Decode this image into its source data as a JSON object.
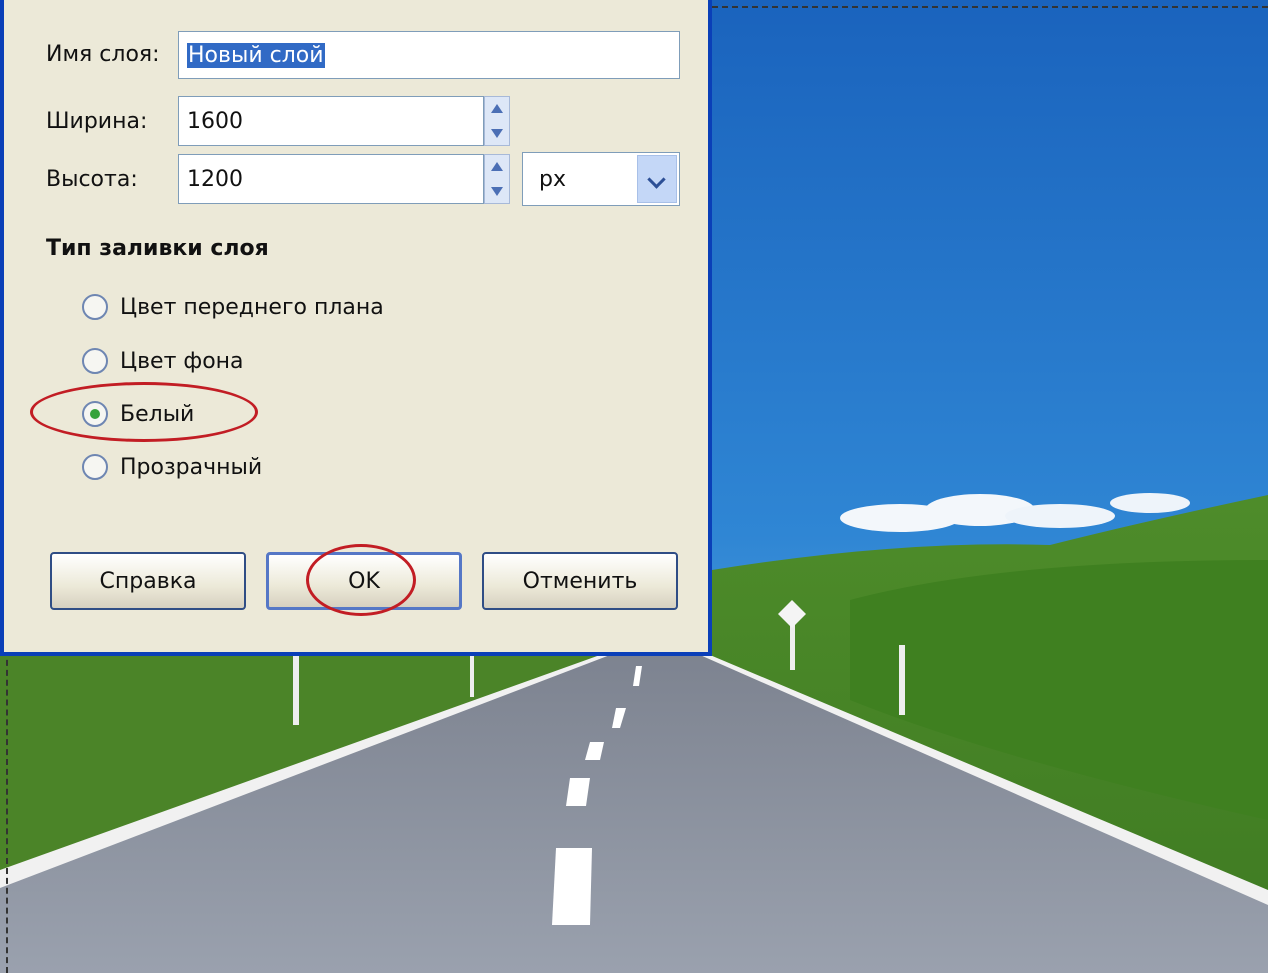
{
  "dialog": {
    "layer_name_label": "Имя слоя:",
    "layer_name_value": "Новый слой",
    "width_label": "Ширина:",
    "width_value": "1600",
    "height_label": "Высота:",
    "height_value": "1200",
    "unit_value": "px",
    "fill_type_heading": "Тип заливки слоя",
    "fill_options": [
      {
        "label": "Цвет переднего плана",
        "selected": false
      },
      {
        "label": "Цвет фона",
        "selected": false
      },
      {
        "label": "Белый",
        "selected": true
      },
      {
        "label": "Прозрачный",
        "selected": false
      }
    ],
    "buttons": {
      "help": "Справка",
      "ok": "OK",
      "cancel": "Отменить"
    }
  },
  "colors": {
    "dialog_bg": "#ece9d8",
    "title_blue": "#0a3fb8",
    "annotation_red": "#c21d24",
    "selection_blue": "#316ac5"
  },
  "icons": [
    "spin-up-icon",
    "spin-down-icon",
    "chevron-down-icon"
  ]
}
